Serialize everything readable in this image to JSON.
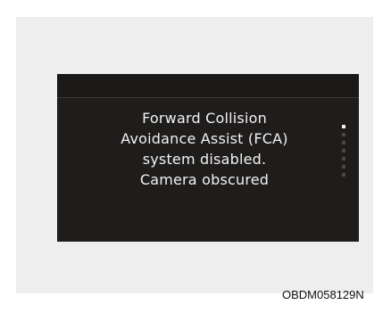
{
  "display": {
    "message_lines": [
      "Forward Collision",
      "Avoidance Assist (FCA)",
      "system disabled.",
      "Camera obscured"
    ],
    "page_indicator": {
      "total": 7,
      "active_index": 0
    }
  },
  "image_code": "OBDM058129N"
}
